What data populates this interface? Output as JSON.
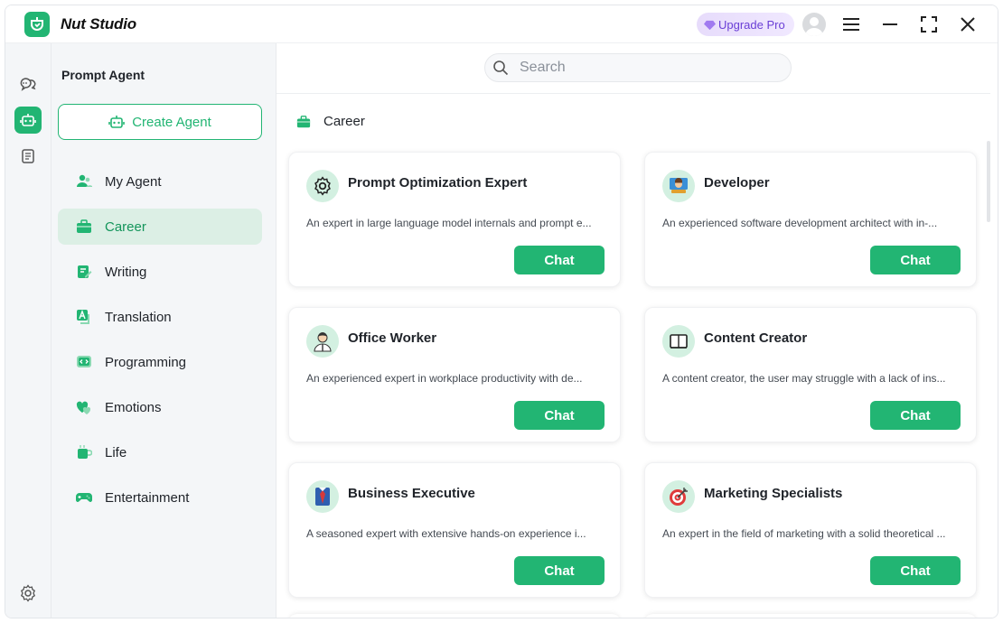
{
  "app": {
    "title": "Nut Studio",
    "upgrade_label": "Upgrade Pro"
  },
  "sidebar": {
    "title": "Prompt Agent",
    "create_label": "Create Agent",
    "items": [
      {
        "label": "My Agent",
        "icon": "users-icon"
      },
      {
        "label": "Career",
        "icon": "briefcase-icon"
      },
      {
        "label": "Writing",
        "icon": "pen-note-icon"
      },
      {
        "label": "Translation",
        "icon": "translate-icon"
      },
      {
        "label": "Programming",
        "icon": "code-icon"
      },
      {
        "label": "Emotions",
        "icon": "hearts-icon"
      },
      {
        "label": "Life",
        "icon": "cup-icon"
      },
      {
        "label": "Entertainment",
        "icon": "gamepad-icon"
      }
    ]
  },
  "search": {
    "placeholder": "Search"
  },
  "section": {
    "title": "Career"
  },
  "cards": [
    {
      "name": "Prompt Optimization Expert",
      "desc": "An expert in large language model internals and prompt e...",
      "chat": "Chat",
      "icon": "gear-icon"
    },
    {
      "name": "Developer",
      "desc": "An experienced software development architect with in-...",
      "chat": "Chat",
      "icon": "developer-icon"
    },
    {
      "name": "Office Worker",
      "desc": "An experienced expert in workplace productivity with de...",
      "chat": "Chat",
      "icon": "office-worker-icon"
    },
    {
      "name": "Content Creator",
      "desc": "A content creator, the user may struggle with a lack of ins...",
      "chat": "Chat",
      "icon": "book-icon"
    },
    {
      "name": "Business Executive",
      "desc": "A seasoned expert with extensive hands-on experience i...",
      "chat": "Chat",
      "icon": "executive-icon"
    },
    {
      "name": "Marketing Specialists",
      "desc": "An expert in the field of marketing with a solid theoretical ...",
      "chat": "Chat",
      "icon": "target-icon"
    }
  ],
  "colors": {
    "accent": "#22b573",
    "active_bg": "#dcefe5",
    "avatar_bg": "#d3f0e1",
    "upgrade_text": "#6a3fd6"
  }
}
